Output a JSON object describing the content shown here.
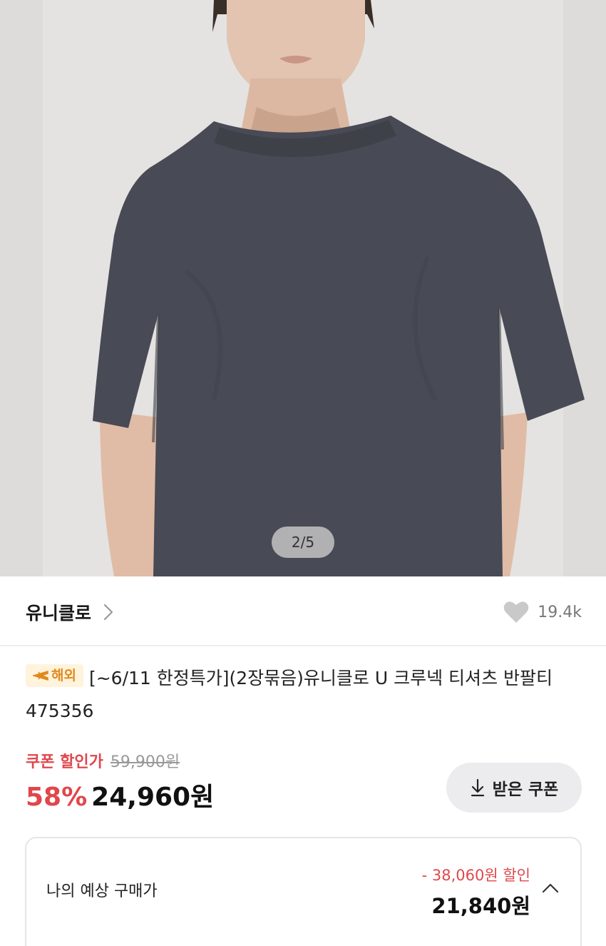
{
  "gallery": {
    "pager_text": "2/5"
  },
  "brand": {
    "name": "유니클로",
    "chevron_icon": "chevron-right-icon",
    "wish_icon": "heart-icon",
    "wish_count": "19.4k"
  },
  "product": {
    "badge_icon": "airplane-icon",
    "badge_label": "해외",
    "title": "[~6/11 한정특가](2장묶음)유니클로 U 크루넥 티셔츠 반팔티 475356"
  },
  "price": {
    "coupon_label": "쿠폰 할인가",
    "original_price": "59,900원",
    "discount_rate": "58%",
    "sale_price": "24,960원"
  },
  "coupon_button": {
    "icon": "download-icon",
    "label": "받은 쿠폰"
  },
  "expected_price": {
    "label": "나의 예상 구매가",
    "discount_text": "- 38,060원 할인",
    "price": "21,840원",
    "toggle_icon": "chevron-up-icon"
  },
  "colors": {
    "accent_red": "#e0474c",
    "badge_bg": "#fff3dc",
    "badge_text": "#e08a1e",
    "shirt": "#484a55"
  }
}
